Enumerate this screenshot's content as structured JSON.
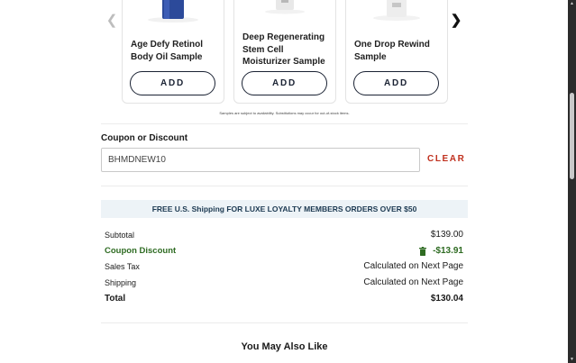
{
  "carousel": {
    "prev_icon": "chevron-left-icon",
    "next_icon": "chevron-right-icon",
    "items": [
      {
        "name": "Age Defy Retinol Body Oil Sample",
        "add_label": "ADD"
      },
      {
        "name": "Deep Regenerating Stem Cell Moisturizer Sample",
        "add_label": "ADD"
      },
      {
        "name": "One Drop Rewind Sample",
        "add_label": "ADD"
      }
    ]
  },
  "samples_note": "Samples are subject to availability. Substitutions may occur for out-of-stock items.",
  "coupon": {
    "label": "Coupon or Discount",
    "value": "BHMDNEW10",
    "clear_label": "CLEAR"
  },
  "shipping_banner": "FREE U.S. Shipping FOR LUXE LOYALTY MEMBERS ORDERS OVER $50",
  "summary": {
    "subtotal_label": "Subtotal",
    "subtotal_value": "$139.00",
    "discount_label": "Coupon Discount",
    "discount_value": "-$13.91",
    "tax_label": "Sales Tax",
    "tax_value": "Calculated on Next Page",
    "shipping_label": "Shipping",
    "shipping_value": "Calculated on Next Page",
    "total_label": "Total",
    "total_value": "$130.04"
  },
  "recommendations_heading": "You May Also Like",
  "colors": {
    "accent_red": "#c0301e",
    "discount_green": "#2e6b22",
    "banner_bg": "#edf3f7"
  }
}
